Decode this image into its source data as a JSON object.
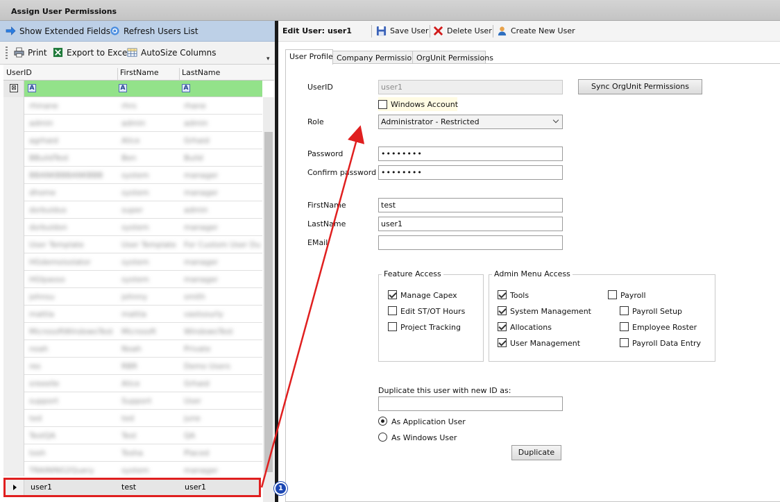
{
  "window": {
    "title": "Assign User Permissions"
  },
  "left_toolbar": {
    "show_extended_fields": "Show Extended Fields",
    "refresh_users_list": "Refresh Users List",
    "print": "Print",
    "export_to_excel": "Export to Excel",
    "autosize_columns": "AutoSize Columns"
  },
  "grid": {
    "columns": [
      "UserID",
      "FirstName",
      "LastName"
    ],
    "blurred_rows": [
      [
        "rhinane",
        "rhrs",
        "rhane"
      ],
      [
        "admin",
        "admin",
        "admin"
      ],
      [
        "agrhaid",
        "Alice",
        "Grhaid"
      ],
      [
        "BBuildTest",
        "Ben",
        "Build"
      ],
      [
        "BBANKBBBANKBBB",
        "system",
        "manager"
      ],
      [
        "dhome",
        "system",
        "manager"
      ],
      [
        "dsrbuldus",
        "super",
        "admin"
      ],
      [
        "dsrbuldon",
        "system",
        "manager"
      ],
      [
        "User Template",
        "User Template",
        "For Custom User Dup"
      ],
      [
        "HGdemoisolator",
        "system",
        "manager"
      ],
      [
        "HGlpasso",
        "system",
        "manager"
      ],
      [
        "johnsu",
        "johnny",
        "smith"
      ],
      [
        "mattia",
        "mattia",
        "vastsourly"
      ],
      [
        "MicrosoftWindowsTest",
        "Microsoft",
        "WindowsTest"
      ],
      [
        "noah",
        "Noah",
        "Private"
      ],
      [
        "res",
        "RBR",
        "Demo Users"
      ],
      [
        "sreeelle",
        "Alice",
        "Grhaid"
      ],
      [
        "support",
        "Support",
        "User"
      ],
      [
        "ted",
        "ted",
        "june"
      ],
      [
        "TestQA",
        "Test",
        "QA"
      ],
      [
        "tosh",
        "Tosha",
        "Placed"
      ],
      [
        "TRAINING2Query",
        "system",
        "manager"
      ]
    ],
    "selected_row": {
      "user_id": "user1",
      "first_name": "test",
      "last_name": "user1"
    }
  },
  "edit_toolbar": {
    "edit_user_label": "Edit User:",
    "edit_user_value": "user1",
    "save_user": "Save User",
    "delete_user": "Delete User",
    "create_new_user": "Create New User"
  },
  "tabs": [
    "User Profile",
    "Company Permissions",
    "OrgUnit Permissions"
  ],
  "profile": {
    "userid_label": "UserID",
    "userid_value": "user1",
    "sync_button": "Sync OrgUnit Permissions",
    "windows_account_label": "Windows Account",
    "windows_account_checked": false,
    "role_label": "Role",
    "role_value": "Administrator - Restricted",
    "password_label": "Password",
    "password_value": "••••••••",
    "confirm_password_label": "Confirm password",
    "confirm_password_value": "••••••••",
    "firstname_label": "FirstName",
    "firstname_value": "test",
    "lastname_label": "LastName",
    "lastname_value": "user1",
    "email_label": "EMail",
    "email_value": ""
  },
  "feature_access": {
    "title": "Feature Access",
    "items": [
      {
        "label": "Manage Capex",
        "checked": true
      },
      {
        "label": "Edit ST/OT Hours",
        "checked": false
      },
      {
        "label": "Project Tracking",
        "checked": false
      }
    ]
  },
  "admin_menu_access": {
    "title": "Admin Menu Access",
    "items": [
      {
        "label": "Tools",
        "checked": true
      },
      {
        "label": "System Management",
        "checked": true
      },
      {
        "label": "Allocations",
        "checked": true
      },
      {
        "label": "User Management",
        "checked": true
      }
    ],
    "payroll": {
      "label": "Payroll",
      "checked": false
    },
    "payroll_items": [
      {
        "label": "Payroll Setup",
        "checked": false
      },
      {
        "label": "Employee Roster",
        "checked": false
      },
      {
        "label": "Payroll Data Entry",
        "checked": false
      }
    ]
  },
  "duplicate": {
    "label": "Duplicate this user with new ID as:",
    "value": "",
    "as_application_user": "As Application User",
    "as_windows_user": "As Windows User",
    "selected": "application",
    "button": "Duplicate"
  },
  "annotation": {
    "badge": "1",
    "color": "#e01f1f"
  }
}
